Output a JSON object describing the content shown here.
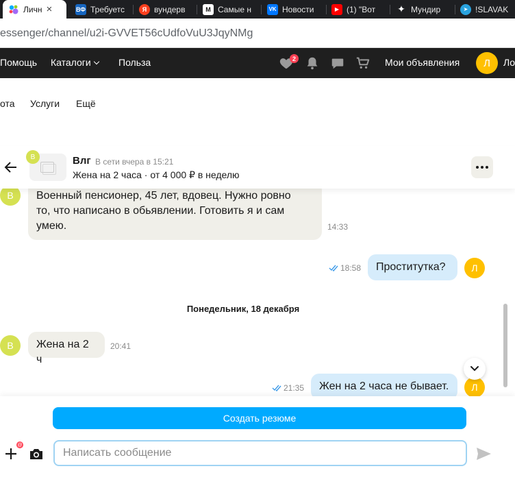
{
  "browser": {
    "tabs": [
      {
        "label": "Личн",
        "favicon": "avito-icon",
        "color": "#ff4053",
        "active": true
      },
      {
        "label": "Требуетс",
        "favicon": "vf-icon",
        "color": "#1565c0",
        "fav_text": "ВФ"
      },
      {
        "label": "вундерв",
        "favicon": "yandex-icon",
        "color": "#fc3f1d",
        "fav_text": "Я"
      },
      {
        "label": "Самые н",
        "favicon": "m-icon",
        "color": "#111111",
        "fav_text": "M"
      },
      {
        "label": "Новости",
        "favicon": "vk-icon",
        "color": "#0077ff",
        "fav_text": "VK"
      },
      {
        "label": "(1) \"Вот",
        "favicon": "youtube-icon",
        "color": "#ff0000",
        "fav_text": "▶"
      },
      {
        "label": "Мундир",
        "favicon": "sparkle-icon",
        "color": "#1e1f22",
        "fav_text": "✦"
      },
      {
        "label": "!SLAVAK",
        "favicon": "telegram-icon",
        "color": "#2aa3df",
        "fav_text": "➤"
      }
    ],
    "url": "essenger/channel/u2i-GVVET56cUdfoVuU3JqyNMg"
  },
  "header": {
    "nav": [
      "Помощь",
      "Каталоги",
      "Польза"
    ],
    "favorites_badge": "2",
    "my_ads": "Мои объявления",
    "user_initial": "Л",
    "user_name_partial": "Ло"
  },
  "subnav": [
    "ота",
    "Услуги",
    "Ещё"
  ],
  "chat": {
    "seller_initial": "В",
    "name": "Влг",
    "status": "В сети вчера в 15:21",
    "ad_line": "Жена на 2 часа · от 4 000 ₽ в неделю"
  },
  "messages": [
    {
      "side": "in",
      "avatar": "В",
      "text_lines": [
        "Военный пенсионер, 45 лет, вдовец. Нужно ровно",
        "то, что написано в обьявлении. Готовить я и сам",
        "умею."
      ],
      "time": "14:33"
    },
    {
      "side": "out",
      "avatar": "Л",
      "text": "Проститутка?",
      "time": "18:58"
    },
    {
      "date": "Понедельник, 18 декабря"
    },
    {
      "side": "in",
      "avatar": "В",
      "text": "Жена на 2 ч",
      "time": "20:41"
    },
    {
      "side": "out",
      "avatar": "Л",
      "text": "Жен на 2 часа не бывает.",
      "time": "21:35"
    }
  ],
  "composer": {
    "cv_button": "Создать резюме",
    "placeholder": "Написать сообщение",
    "attach_badge": "@"
  },
  "colors": {
    "primary": "#00aaff",
    "incoming_bubble": "#f0efe9",
    "outgoing_bubble": "#d6ecfb",
    "seller_avatar": "#d5e152",
    "user_avatar": "#ffc000",
    "header_bg": "#1f1f1f"
  }
}
